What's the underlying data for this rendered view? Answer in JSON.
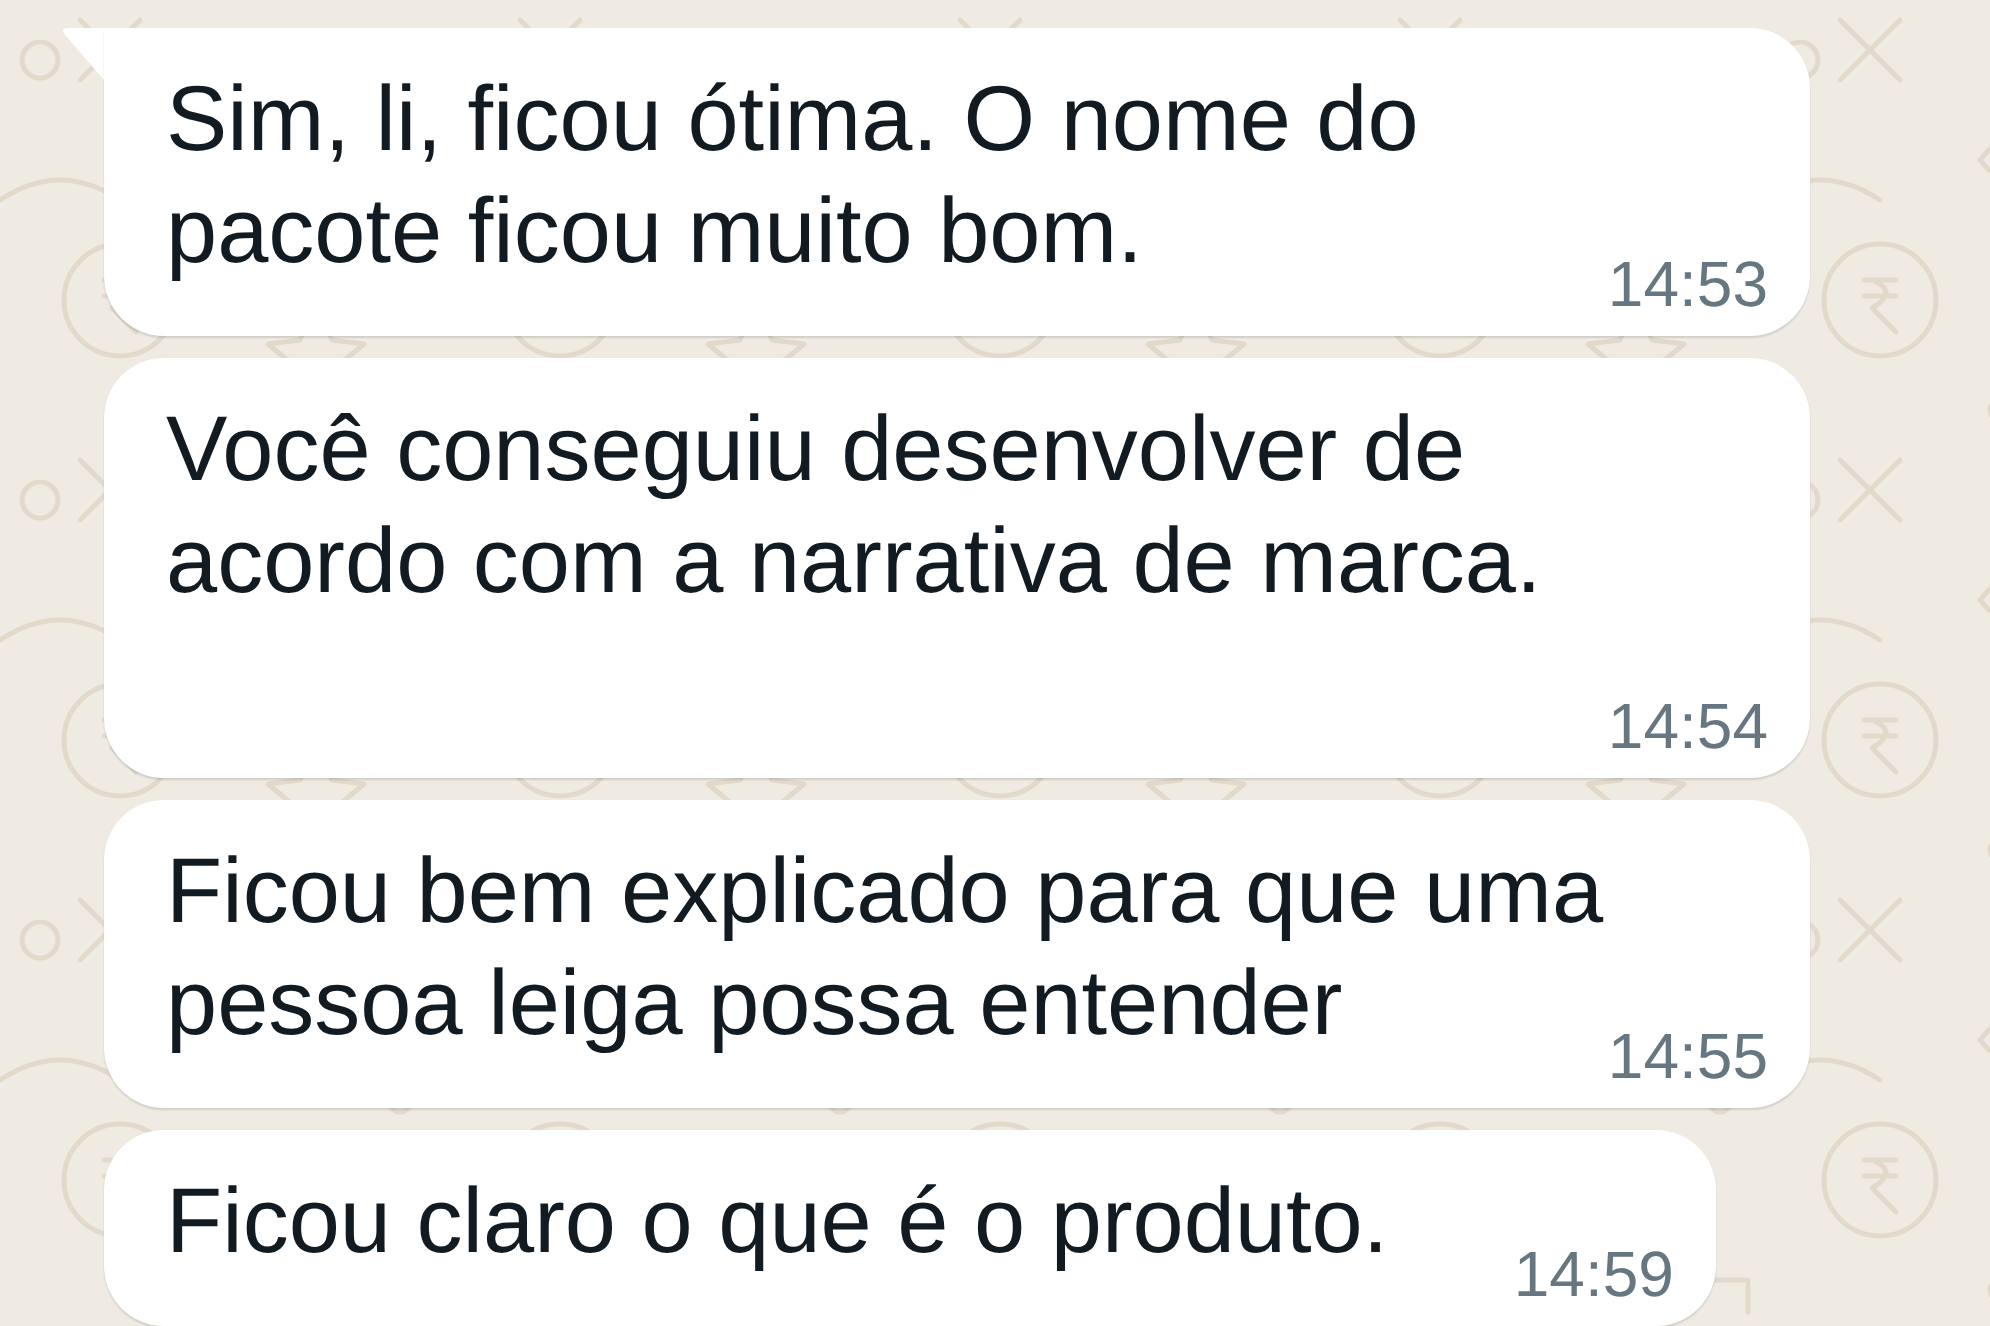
{
  "messages": [
    {
      "lines": [
        "Sim, li, ficou ótima. O nome do",
        "pacote ficou muito bom."
      ],
      "time": "14:53",
      "tail": true
    },
    {
      "lines": [
        "Você conseguiu desenvolver de",
        "acordo com a narrativa de marca."
      ],
      "time": "14:54",
      "tail": false
    },
    {
      "lines": [
        "Ficou bem explicado para que uma",
        "pessoa leiga possa entender"
      ],
      "time": "14:55",
      "tail": false
    },
    {
      "lines": [
        "Ficou claro o que é o produto."
      ],
      "time": "14:59",
      "tail": false
    }
  ]
}
